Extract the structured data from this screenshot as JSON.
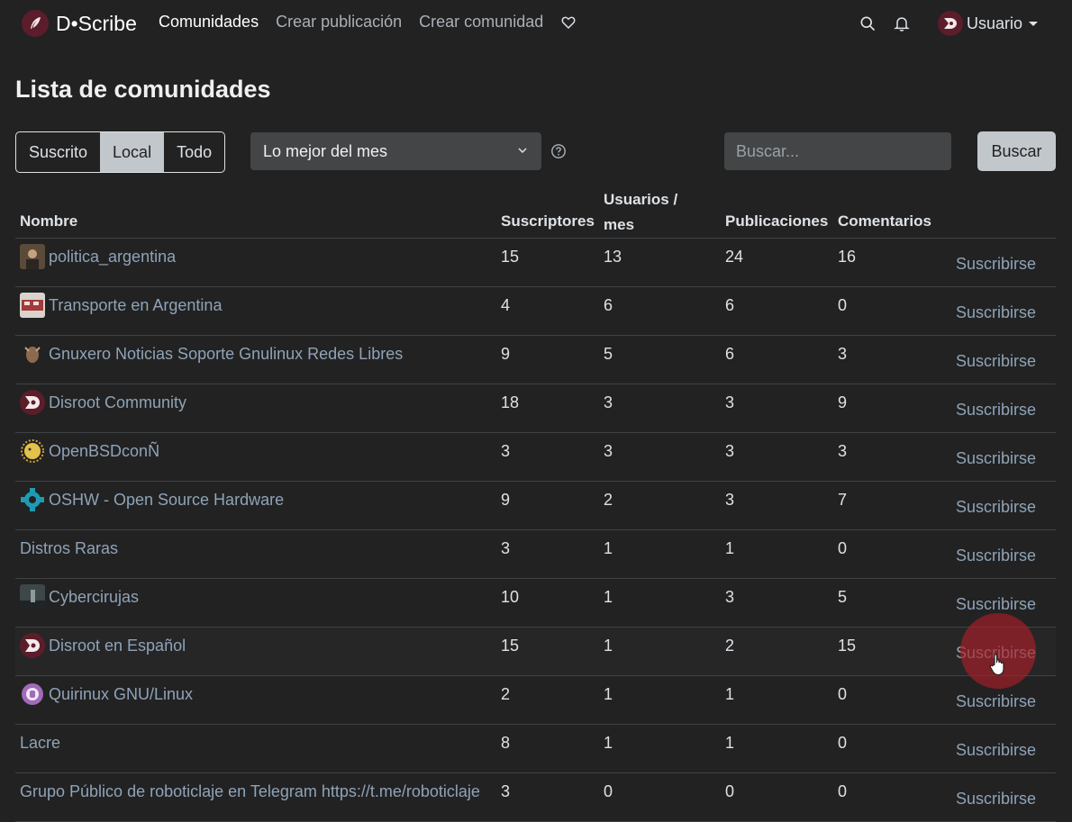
{
  "brand": {
    "name": "D•Scribe",
    "logo_icon": "quill-icon"
  },
  "nav": {
    "links": [
      "Comunidades",
      "Crear publicación",
      "Crear comunidad"
    ],
    "donate_icon": "heart-icon"
  },
  "user": {
    "name": "Usuario"
  },
  "page": {
    "title": "Lista de comunidades"
  },
  "filters": {
    "listing_types": [
      "Suscrito",
      "Local",
      "Todo"
    ],
    "selected_listing": "Local",
    "sort": "Lo mejor del mes",
    "search_placeholder": "Buscar...",
    "search_button": "Buscar"
  },
  "table": {
    "headers": {
      "name": "Nombre",
      "subscribers": "Suscriptores",
      "users_month_line1": "Usuarios /",
      "users_month_line2": "mes",
      "posts": "Publicaciones",
      "comments": "Comentarios"
    },
    "rows": [
      {
        "name": "politica_argentina",
        "icon": "portrait",
        "subs": "15",
        "users": "13",
        "posts": "24",
        "comments": "16",
        "action": "Suscribirse"
      },
      {
        "name": "Transporte en Argentina",
        "icon": "train",
        "subs": "4",
        "users": "6",
        "posts": "6",
        "comments": "0",
        "action": "Suscribirse"
      },
      {
        "name": "Gnuxero Noticias Soporte Gnulinux Redes Libres",
        "icon": "gnu",
        "subs": "9",
        "users": "5",
        "posts": "6",
        "comments": "3",
        "action": "Suscribirse"
      },
      {
        "name": "Disroot Community",
        "icon": "disroot",
        "subs": "18",
        "users": "3",
        "posts": "3",
        "comments": "9",
        "action": "Suscribirse"
      },
      {
        "name": "OpenBSDconÑ",
        "icon": "puffer",
        "subs": "3",
        "users": "3",
        "posts": "3",
        "comments": "3",
        "action": "Suscribirse"
      },
      {
        "name": "OSHW - Open Source Hardware",
        "icon": "gear",
        "subs": "9",
        "users": "2",
        "posts": "3",
        "comments": "7",
        "action": "Suscribirse"
      },
      {
        "name": "Distros Raras",
        "icon": "",
        "subs": "3",
        "users": "1",
        "posts": "1",
        "comments": "0",
        "action": "Suscribirse"
      },
      {
        "name": "Cybercirujas",
        "icon": "photo",
        "subs": "10",
        "users": "1",
        "posts": "3",
        "comments": "5",
        "action": "Suscribirse"
      },
      {
        "name": "Disroot en Español",
        "icon": "disroot",
        "subs": "15",
        "users": "1",
        "posts": "2",
        "comments": "15",
        "action": "Suscribirse"
      },
      {
        "name": "Quirinux GNU/Linux",
        "icon": "quirinux",
        "subs": "2",
        "users": "1",
        "posts": "1",
        "comments": "0",
        "action": "Suscribirse"
      },
      {
        "name": "Lacre",
        "icon": "",
        "subs": "8",
        "users": "1",
        "posts": "1",
        "comments": "0",
        "action": "Suscribirse"
      },
      {
        "name": "Grupo Público de roboticlaje en Telegram https://t.me/roboticlaje",
        "icon": "",
        "subs": "3",
        "users": "0",
        "posts": "0",
        "comments": "0",
        "action": "Suscribirse"
      }
    ]
  }
}
